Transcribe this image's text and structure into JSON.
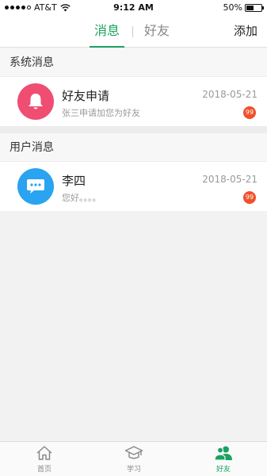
{
  "status_bar": {
    "carrier": "AT&T",
    "time": "9:12 AM",
    "battery": "50%",
    "battery_level": 0.5
  },
  "nav": {
    "tabs": [
      {
        "label": "消息",
        "active": true
      },
      {
        "label": "好友",
        "active": false
      }
    ],
    "add_label": "添加"
  },
  "system_section": {
    "title": "系统消息",
    "items": [
      {
        "name": "好友申请",
        "preview": "张三申请加您为好友",
        "date": "2018-05-21",
        "badge": "99",
        "icon": "bell-icon",
        "color": "#ef4e72"
      }
    ]
  },
  "user_section": {
    "title": "用户消息",
    "items": [
      {
        "name": "李四",
        "preview": "您好。。。。",
        "date": "2018-05-21",
        "badge": "99",
        "icon": "chat-bubble-icon",
        "color": "#2aa3f0"
      }
    ]
  },
  "tab_bar": {
    "items": [
      {
        "label": "首页",
        "icon": "home-icon",
        "active": false
      },
      {
        "label": "学习",
        "icon": "graduation-cap-icon",
        "active": false
      },
      {
        "label": "好友",
        "icon": "friends-icon",
        "active": true
      }
    ]
  },
  "colors": {
    "accent": "#1aa260",
    "badge": "#f0502a"
  }
}
